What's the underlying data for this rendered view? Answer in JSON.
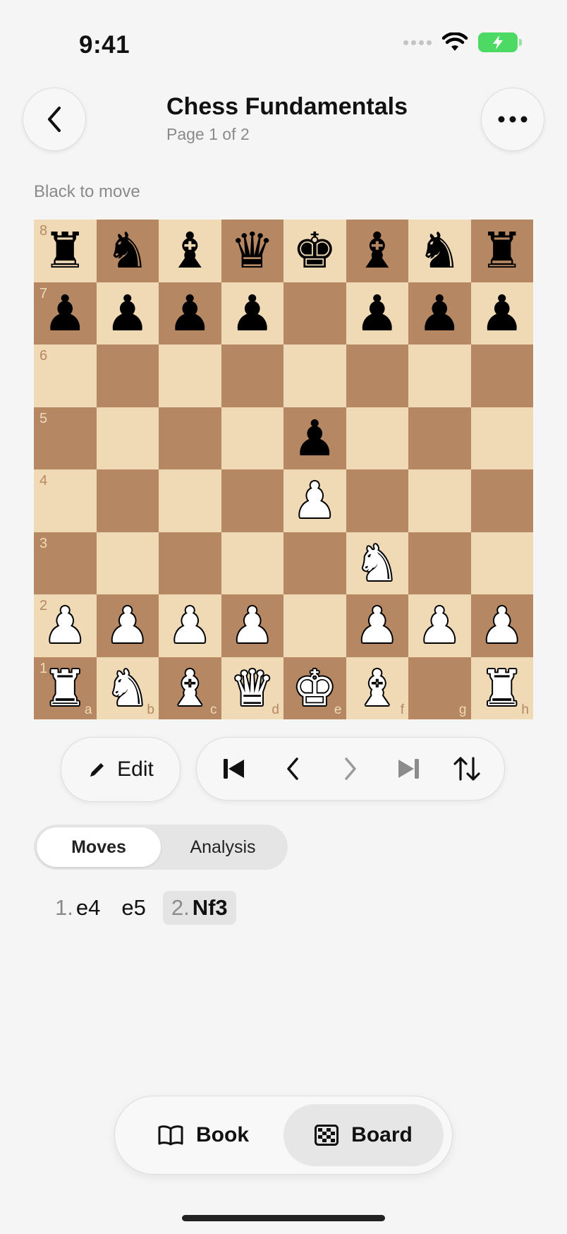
{
  "status_bar": {
    "time": "9:41"
  },
  "header": {
    "title": "Chess Fundamentals",
    "subtitle": "Page 1 of 2"
  },
  "turn_text": "Black to move",
  "board": {
    "files": [
      "a",
      "b",
      "c",
      "d",
      "e",
      "f",
      "g",
      "h"
    ],
    "ranks": [
      "8",
      "7",
      "6",
      "5",
      "4",
      "3",
      "2",
      "1"
    ],
    "light_color": "#f0d9b5",
    "dark_color": "#b58863",
    "position": [
      [
        "br",
        "bn",
        "bb",
        "bq",
        "bk",
        "bb",
        "bn",
        "br"
      ],
      [
        "bp",
        "bp",
        "bp",
        "bp",
        "",
        "bp",
        "bp",
        "bp"
      ],
      [
        "",
        "",
        "",
        "",
        "",
        "",
        "",
        ""
      ],
      [
        "",
        "",
        "",
        "",
        "bp",
        "",
        "",
        ""
      ],
      [
        "",
        "",
        "",
        "",
        "wp",
        "",
        "",
        ""
      ],
      [
        "",
        "",
        "",
        "",
        "",
        "wn",
        "",
        ""
      ],
      [
        "wp",
        "wp",
        "wp",
        "wp",
        "",
        "wp",
        "wp",
        "wp"
      ],
      [
        "wr",
        "wn",
        "wb",
        "wq",
        "wk",
        "wb",
        "",
        "wr"
      ]
    ]
  },
  "controls": {
    "edit_label": "Edit",
    "nav_icons": [
      "skip-to-start-icon",
      "previous-icon",
      "next-icon",
      "skip-to-end-icon",
      "flip-board-icon"
    ]
  },
  "segmented": {
    "moves_label": "Moves",
    "analysis_label": "Analysis",
    "selected": "Moves"
  },
  "moves": [
    {
      "number": "1.",
      "san": "e4"
    },
    {
      "number": "",
      "san": "e5"
    },
    {
      "number": "2.",
      "san": "Nf3",
      "current": true
    }
  ],
  "tabbar": {
    "book_label": "Book",
    "board_label": "Board",
    "selected": "Board"
  },
  "colors": {
    "battery": "#4cd964",
    "background": "#f5f5f5"
  }
}
